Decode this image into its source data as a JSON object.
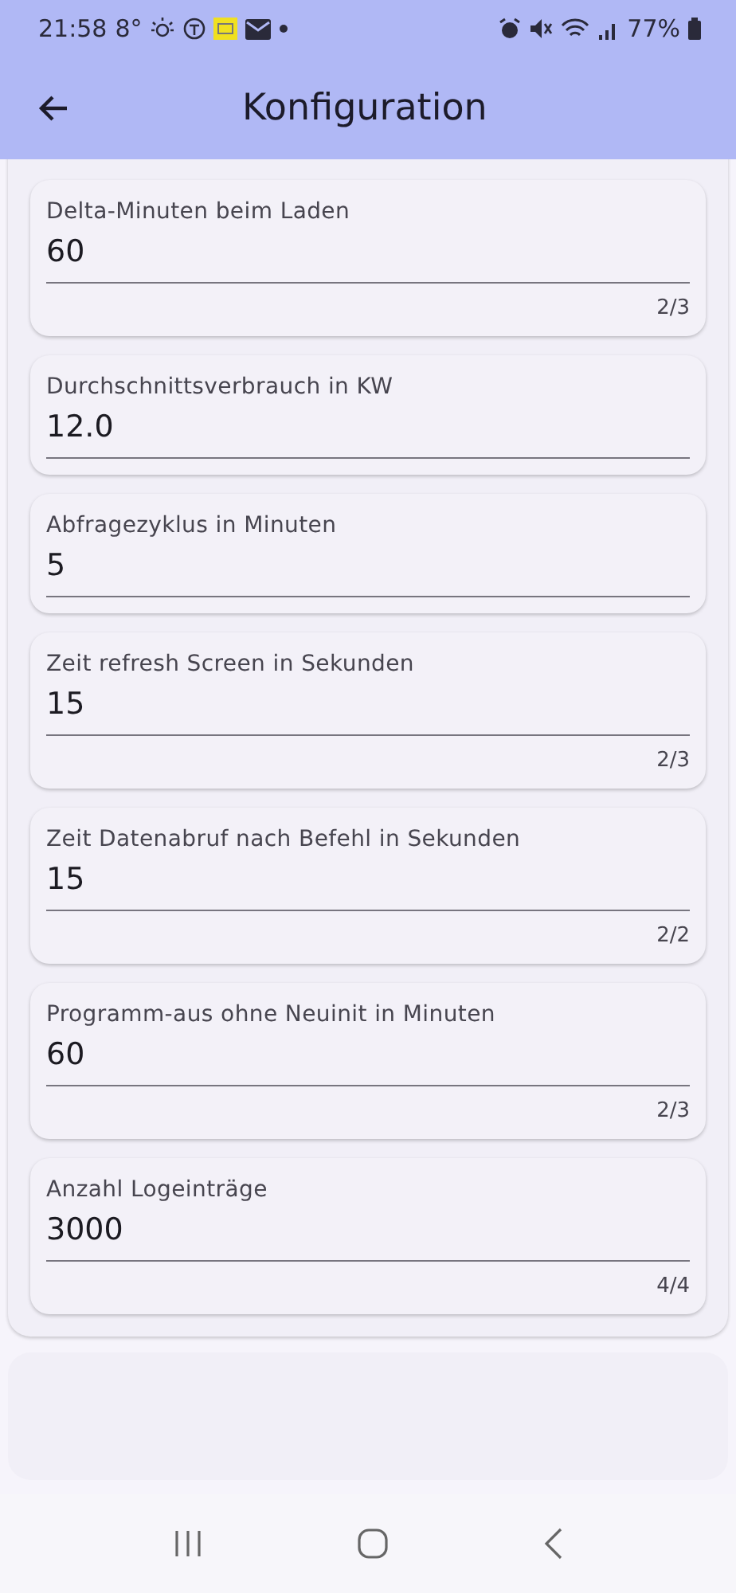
{
  "status_bar": {
    "time": "21:58",
    "temperature": "8°",
    "battery": "77%"
  },
  "app_bar": {
    "title": "Konfiguration"
  },
  "fields": [
    {
      "label": "Delta-Minuten beim Laden",
      "value": "60",
      "counter": "2/3"
    },
    {
      "label": "Durchschnittsverbrauch in KW",
      "value": "12.0"
    },
    {
      "label": "Abfragezyklus in Minuten",
      "value": "5"
    },
    {
      "label": "Zeit refresh Screen in Sekunden",
      "value": "15",
      "counter": "2/3"
    },
    {
      "label": "Zeit Datenabruf nach Befehl in Sekunden",
      "value": "15",
      "counter": "2/2"
    },
    {
      "label": "Programm-aus ohne Neuinit in Minuten",
      "value": "60",
      "counter": "2/3"
    },
    {
      "label": "Anzahl Logeinträge",
      "value": "3000",
      "counter": "4/4"
    }
  ]
}
